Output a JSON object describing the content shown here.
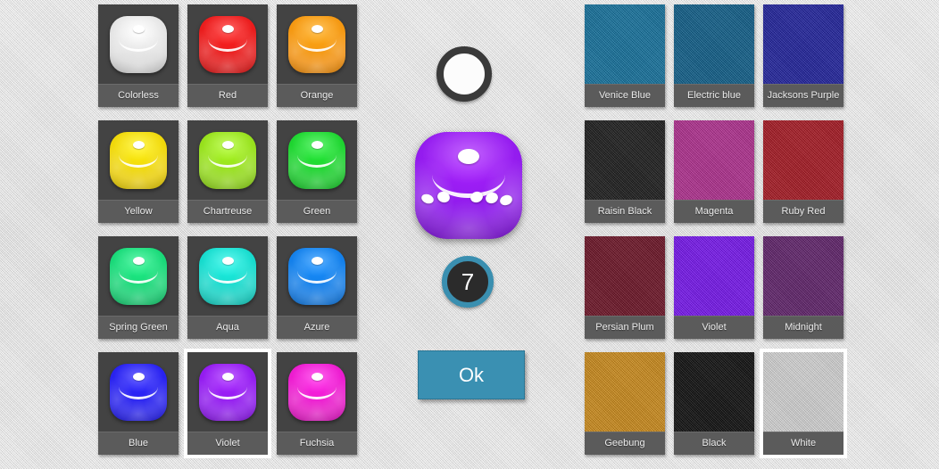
{
  "theme": {
    "background": "#e3e3e3",
    "tile_body": "#434343",
    "tile_label_bar": "#5b5b5b",
    "accent": "#3a90b2",
    "selection_outline": "#ffffff"
  },
  "dice_color_panel": {
    "panel_name": "dice-color-picker",
    "selected": "Violet",
    "tiles": [
      {
        "label": "Colorless",
        "color": "#d8d8d8",
        "selected": false
      },
      {
        "label": "Red",
        "color": "#e01b1b",
        "selected": false
      },
      {
        "label": "Orange",
        "color": "#ef8f10",
        "selected": false
      },
      {
        "label": "Yellow",
        "color": "#e8cc0a",
        "selected": false
      },
      {
        "label": "Chartreuse",
        "color": "#8fd41b",
        "selected": false
      },
      {
        "label": "Green",
        "color": "#1dc92e",
        "selected": false
      },
      {
        "label": "Spring Green",
        "color": "#18cd72",
        "selected": false
      },
      {
        "label": "Aqua",
        "color": "#16cfc2",
        "selected": false
      },
      {
        "label": "Azure",
        "color": "#1379e0",
        "selected": false
      },
      {
        "label": "Blue",
        "color": "#2620e8",
        "selected": false
      },
      {
        "label": "Violet",
        "color": "#8b1ae8",
        "selected": true
      },
      {
        "label": "Fuchsia",
        "color": "#e31ac4",
        "selected": false
      }
    ]
  },
  "fabric_color_panel": {
    "panel_name": "table-fabric-picker",
    "selected": "White",
    "tiles": [
      {
        "label": "Venice Blue",
        "color": "#11709c",
        "selected": false
      },
      {
        "label": "Electric blue",
        "color": "#0c5c88",
        "selected": false
      },
      {
        "label": "Jacksons Purple",
        "color": "#1d1f9c",
        "selected": false
      },
      {
        "label": "Raisin Black",
        "color": "#191919",
        "selected": false
      },
      {
        "label": "Magenta",
        "color": "#b02c8e",
        "selected": false
      },
      {
        "label": "Ruby Red",
        "color": "#a6151f",
        "selected": false
      },
      {
        "label": "Persian Plum",
        "color": "#6b1023",
        "selected": false
      },
      {
        "label": "Violet",
        "color": "#7512ef",
        "selected": false
      },
      {
        "label": "Midnight",
        "color": "#5e1f69",
        "selected": false
      },
      {
        "label": "Geebung",
        "color": "#cc8a18",
        "selected": false
      },
      {
        "label": "Black",
        "color": "#0b0b0b",
        "selected": false
      },
      {
        "label": "White",
        "color": "#d5d5d5",
        "selected": true
      }
    ]
  },
  "center_panel": {
    "pip_color_swatch": {
      "name": "pip-color-swatch",
      "color": "#fcfcfc",
      "ring_color": "#3a3a3a"
    },
    "die_preview": {
      "name": "die-preview",
      "color": "#8b1ae8",
      "pip_color": "#ffffff"
    },
    "dice_count": {
      "name": "dice-count-badge",
      "value": "7",
      "ring_color": "#3a8fb0"
    },
    "ok_button": {
      "name": "ok-button",
      "label": "Ok"
    }
  }
}
